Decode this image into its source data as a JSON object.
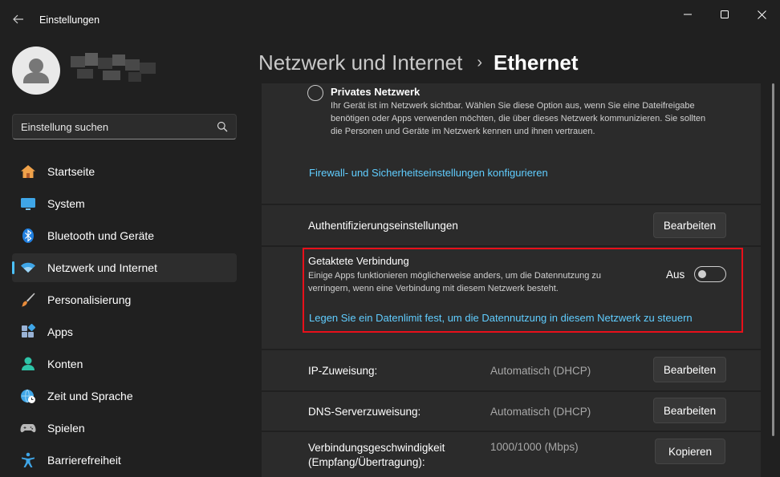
{
  "window": {
    "title": "Einstellungen",
    "back_icon": "arrow-left-icon",
    "controls": [
      "minimize-icon",
      "maximize-icon",
      "close-icon"
    ]
  },
  "search": {
    "placeholder": "Einstellung suchen",
    "value": ""
  },
  "sidebar": {
    "items": [
      {
        "label": "Startseite",
        "icon": "home-icon",
        "active": false
      },
      {
        "label": "System",
        "icon": "monitor-icon",
        "active": false
      },
      {
        "label": "Bluetooth und Geräte",
        "icon": "bluetooth-icon",
        "active": false
      },
      {
        "label": "Netzwerk und Internet",
        "icon": "wifi-icon",
        "active": true
      },
      {
        "label": "Personalisierung",
        "icon": "brush-icon",
        "active": false
      },
      {
        "label": "Apps",
        "icon": "apps-icon",
        "active": false
      },
      {
        "label": "Konten",
        "icon": "person-icon",
        "active": false
      },
      {
        "label": "Zeit und Sprache",
        "icon": "globe-clock-icon",
        "active": false
      },
      {
        "label": "Spielen",
        "icon": "gamepad-icon",
        "active": false
      },
      {
        "label": "Barrierefreiheit",
        "icon": "accessibility-icon",
        "active": false
      }
    ]
  },
  "breadcrumb": {
    "parent": "Netzwerk und Internet",
    "separator": "›",
    "current": "Ethernet"
  },
  "network_profile": {
    "option_title": "Privates Netzwerk",
    "option_desc": "Ihr Gerät ist im Netzwerk sichtbar. Wählen Sie diese Option aus, wenn Sie eine Dateifreigabe benötigen oder Apps verwenden möchten, die über dieses Netzwerk kommunizieren. Sie sollten die Personen und Geräte im Netzwerk kennen und ihnen vertrauen.",
    "firewall_link": "Firewall- und Sicherheitseinstellungen konfigurieren"
  },
  "auth": {
    "label": "Authentifizierungseinstellungen",
    "button": "Bearbeiten"
  },
  "metered": {
    "title": "Getaktete Verbindung",
    "desc": "Einige Apps funktionieren möglicherweise anders, um die Datennutzung zu verringern, wenn eine Verbindung mit diesem Netzwerk besteht.",
    "toggle_label": "Aus",
    "toggle_on": false,
    "limit_link": "Legen Sie ein Datenlimit fest, um die Datennutzung in diesem Netzwerk zu steuern"
  },
  "ip": {
    "label": "IP-Zuweisung:",
    "value": "Automatisch (DHCP)",
    "button": "Bearbeiten"
  },
  "dns": {
    "label": "DNS-Serverzuweisung:",
    "value": "Automatisch (DHCP)",
    "button": "Bearbeiten"
  },
  "speed": {
    "label_line1": "Verbindungsgeschwindigkeit",
    "label_line2": "(Empfang/Übertragung):",
    "value": "1000/1000 (Mbps)",
    "button": "Kopieren"
  },
  "colors": {
    "accent": "#4cc2ff",
    "link": "#60cdff",
    "highlight": "#e8101a",
    "background": "#202020",
    "card": "#2b2b2b"
  }
}
